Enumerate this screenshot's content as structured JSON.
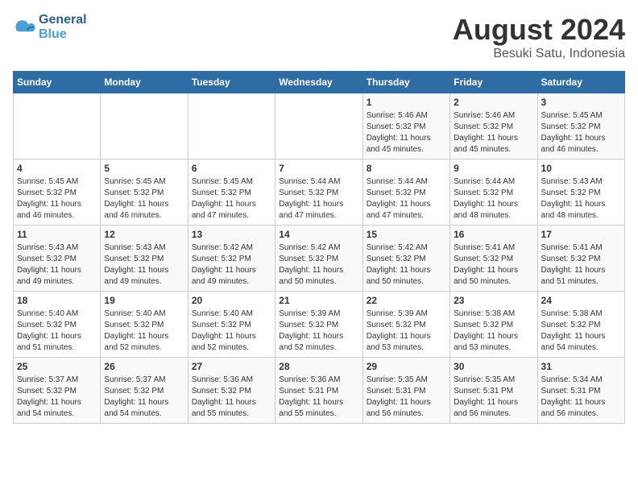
{
  "header": {
    "logo_line1": "General",
    "logo_line2": "Blue",
    "title": "August 2024",
    "subtitle": "Besuki Satu, Indonesia"
  },
  "days_of_week": [
    "Sunday",
    "Monday",
    "Tuesday",
    "Wednesday",
    "Thursday",
    "Friday",
    "Saturday"
  ],
  "weeks": [
    [
      {
        "day": "",
        "info": ""
      },
      {
        "day": "",
        "info": ""
      },
      {
        "day": "",
        "info": ""
      },
      {
        "day": "",
        "info": ""
      },
      {
        "day": "1",
        "info": "Sunrise: 5:46 AM\nSunset: 5:32 PM\nDaylight: 11 hours\nand 45 minutes."
      },
      {
        "day": "2",
        "info": "Sunrise: 5:46 AM\nSunset: 5:32 PM\nDaylight: 11 hours\nand 45 minutes."
      },
      {
        "day": "3",
        "info": "Sunrise: 5:45 AM\nSunset: 5:32 PM\nDaylight: 11 hours\nand 46 minutes."
      }
    ],
    [
      {
        "day": "4",
        "info": "Sunrise: 5:45 AM\nSunset: 5:32 PM\nDaylight: 11 hours\nand 46 minutes."
      },
      {
        "day": "5",
        "info": "Sunrise: 5:45 AM\nSunset: 5:32 PM\nDaylight: 11 hours\nand 46 minutes."
      },
      {
        "day": "6",
        "info": "Sunrise: 5:45 AM\nSunset: 5:32 PM\nDaylight: 11 hours\nand 47 minutes."
      },
      {
        "day": "7",
        "info": "Sunrise: 5:44 AM\nSunset: 5:32 PM\nDaylight: 11 hours\nand 47 minutes."
      },
      {
        "day": "8",
        "info": "Sunrise: 5:44 AM\nSunset: 5:32 PM\nDaylight: 11 hours\nand 47 minutes."
      },
      {
        "day": "9",
        "info": "Sunrise: 5:44 AM\nSunset: 5:32 PM\nDaylight: 11 hours\nand 48 minutes."
      },
      {
        "day": "10",
        "info": "Sunrise: 5:43 AM\nSunset: 5:32 PM\nDaylight: 11 hours\nand 48 minutes."
      }
    ],
    [
      {
        "day": "11",
        "info": "Sunrise: 5:43 AM\nSunset: 5:32 PM\nDaylight: 11 hours\nand 49 minutes."
      },
      {
        "day": "12",
        "info": "Sunrise: 5:43 AM\nSunset: 5:32 PM\nDaylight: 11 hours\nand 49 minutes."
      },
      {
        "day": "13",
        "info": "Sunrise: 5:42 AM\nSunset: 5:32 PM\nDaylight: 11 hours\nand 49 minutes."
      },
      {
        "day": "14",
        "info": "Sunrise: 5:42 AM\nSunset: 5:32 PM\nDaylight: 11 hours\nand 50 minutes."
      },
      {
        "day": "15",
        "info": "Sunrise: 5:42 AM\nSunset: 5:32 PM\nDaylight: 11 hours\nand 50 minutes."
      },
      {
        "day": "16",
        "info": "Sunrise: 5:41 AM\nSunset: 5:32 PM\nDaylight: 11 hours\nand 50 minutes."
      },
      {
        "day": "17",
        "info": "Sunrise: 5:41 AM\nSunset: 5:32 PM\nDaylight: 11 hours\nand 51 minutes."
      }
    ],
    [
      {
        "day": "18",
        "info": "Sunrise: 5:40 AM\nSunset: 5:32 PM\nDaylight: 11 hours\nand 51 minutes."
      },
      {
        "day": "19",
        "info": "Sunrise: 5:40 AM\nSunset: 5:32 PM\nDaylight: 11 hours\nand 52 minutes."
      },
      {
        "day": "20",
        "info": "Sunrise: 5:40 AM\nSunset: 5:32 PM\nDaylight: 11 hours\nand 52 minutes."
      },
      {
        "day": "21",
        "info": "Sunrise: 5:39 AM\nSunset: 5:32 PM\nDaylight: 11 hours\nand 52 minutes."
      },
      {
        "day": "22",
        "info": "Sunrise: 5:39 AM\nSunset: 5:32 PM\nDaylight: 11 hours\nand 53 minutes."
      },
      {
        "day": "23",
        "info": "Sunrise: 5:38 AM\nSunset: 5:32 PM\nDaylight: 11 hours\nand 53 minutes."
      },
      {
        "day": "24",
        "info": "Sunrise: 5:38 AM\nSunset: 5:32 PM\nDaylight: 11 hours\nand 54 minutes."
      }
    ],
    [
      {
        "day": "25",
        "info": "Sunrise: 5:37 AM\nSunset: 5:32 PM\nDaylight: 11 hours\nand 54 minutes."
      },
      {
        "day": "26",
        "info": "Sunrise: 5:37 AM\nSunset: 5:32 PM\nDaylight: 11 hours\nand 54 minutes."
      },
      {
        "day": "27",
        "info": "Sunrise: 5:36 AM\nSunset: 5:32 PM\nDaylight: 11 hours\nand 55 minutes."
      },
      {
        "day": "28",
        "info": "Sunrise: 5:36 AM\nSunset: 5:31 PM\nDaylight: 11 hours\nand 55 minutes."
      },
      {
        "day": "29",
        "info": "Sunrise: 5:35 AM\nSunset: 5:31 PM\nDaylight: 11 hours\nand 56 minutes."
      },
      {
        "day": "30",
        "info": "Sunrise: 5:35 AM\nSunset: 5:31 PM\nDaylight: 11 hours\nand 56 minutes."
      },
      {
        "day": "31",
        "info": "Sunrise: 5:34 AM\nSunset: 5:31 PM\nDaylight: 11 hours\nand 56 minutes."
      }
    ]
  ]
}
